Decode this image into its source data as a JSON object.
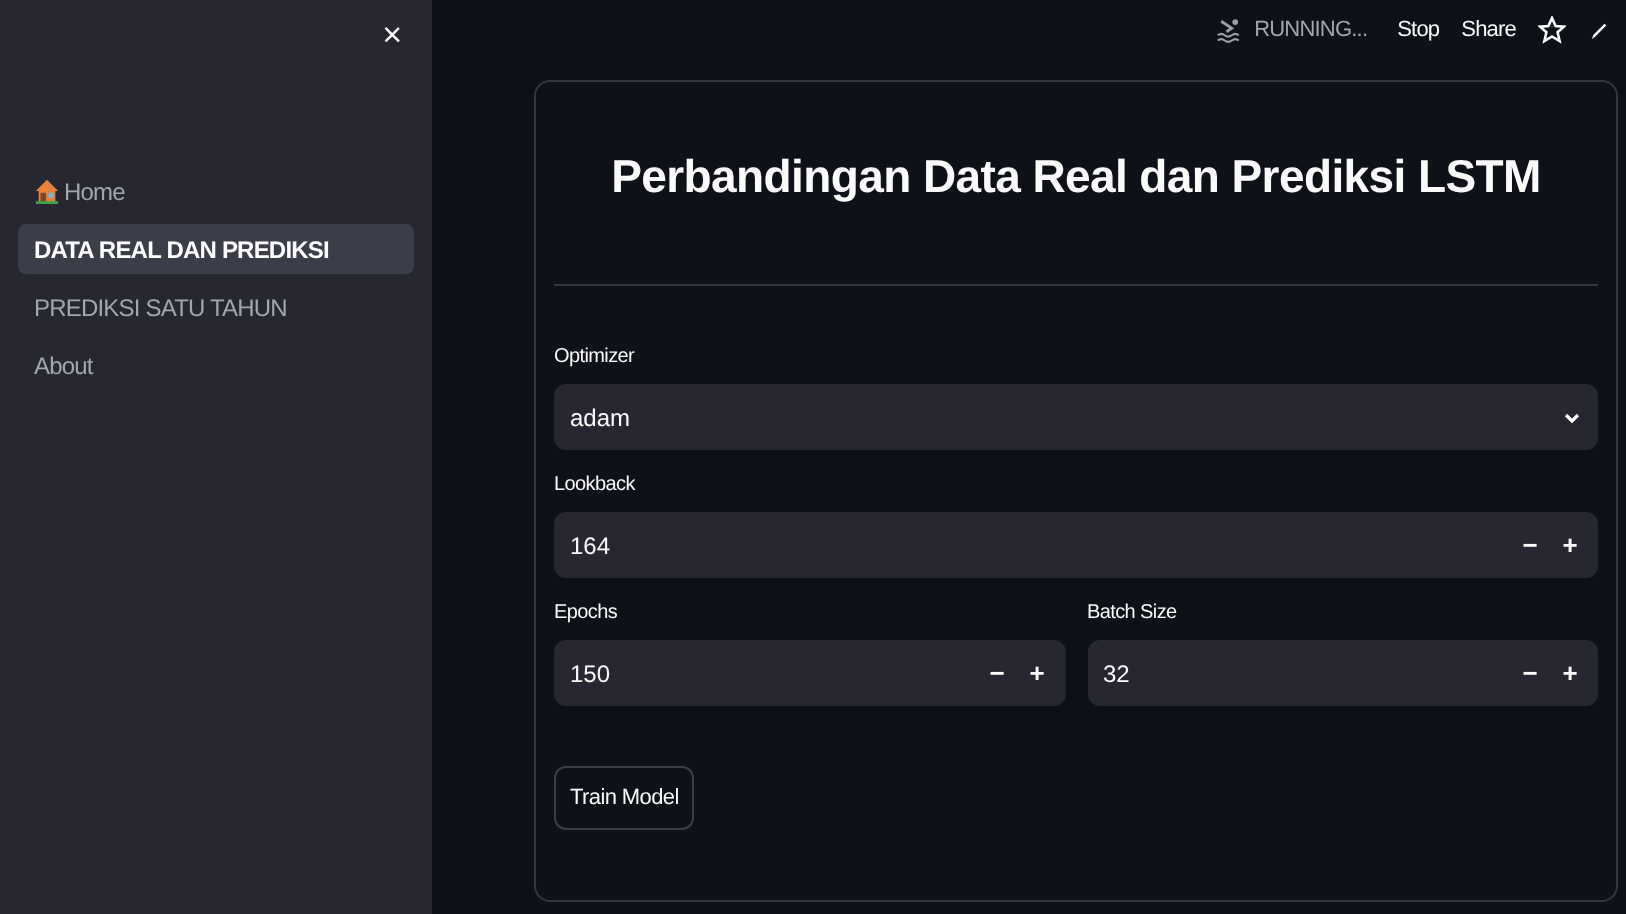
{
  "sidebar": {
    "close": "×",
    "items": [
      {
        "kind": "home",
        "label": "Home",
        "selected": false
      },
      {
        "kind": "page",
        "label": "DATA REAL DAN PREDIKSI",
        "selected": true
      },
      {
        "kind": "page",
        "label": "PREDIKSI SATU TAHUN",
        "selected": false
      },
      {
        "kind": "page",
        "label": "About",
        "selected": false
      }
    ]
  },
  "toolbar": {
    "status": "RUNNING...",
    "actions": [
      "Stop",
      "Share"
    ]
  },
  "main": {
    "title": "Perbandingan Data Real dan Prediksi LSTM",
    "rows": [
      {
        "fields": [
          {
            "kind": "select",
            "label": "Optimizer",
            "value": "adam"
          }
        ]
      },
      {
        "fields": [
          {
            "kind": "number",
            "label": "Lookback",
            "value": "164",
            "minus": "−",
            "plus": "+"
          }
        ]
      },
      {
        "fields": [
          {
            "kind": "number",
            "label": "Epochs",
            "value": "150",
            "minus": "−",
            "plus": "+"
          },
          {
            "kind": "number",
            "label": "Batch Size",
            "value": "32",
            "minus": "−",
            "plus": "+"
          }
        ]
      }
    ],
    "button": "Train Model"
  }
}
